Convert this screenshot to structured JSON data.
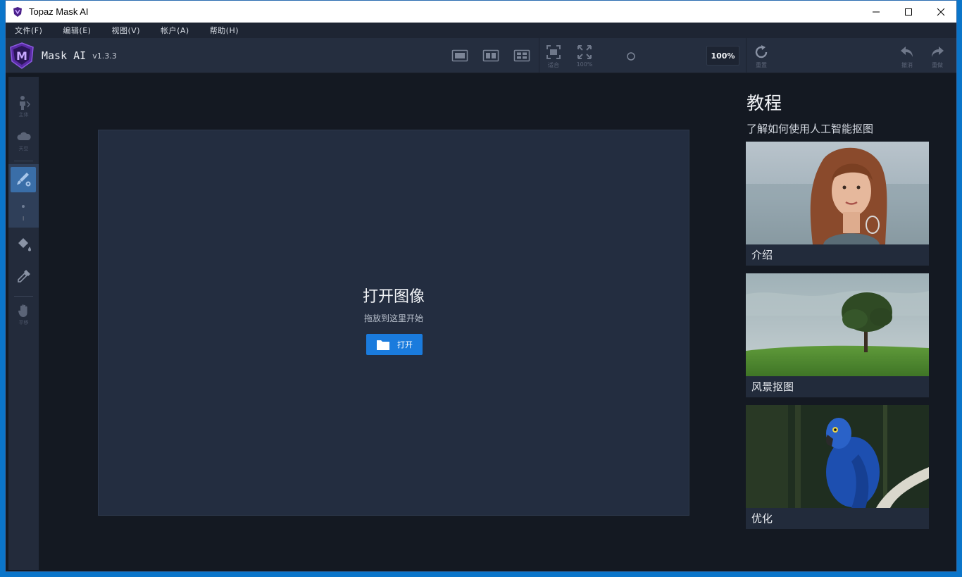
{
  "window": {
    "title": "Topaz Mask AI"
  },
  "menu": [
    "文件(F)",
    "编辑(E)",
    "视图(V)",
    "帐户(A)",
    "帮助(H)"
  ],
  "brand": {
    "name": "Mask AI",
    "version": "v1.3.3",
    "logo_letter": "M"
  },
  "toolbar": {
    "fit_label": "适合",
    "actual_label": "100%",
    "zoom_value": "100%",
    "reset_label": "重置",
    "undo_label": "撤消",
    "redo_label": "重做"
  },
  "tools": {
    "subject_label": "主体",
    "sky_label": "天空",
    "pan_label": "平移"
  },
  "canvas": {
    "title": "打开图像",
    "subtitle": "拖放到这里开始",
    "open_button": "打开"
  },
  "tutorials": {
    "title": "教程",
    "subtitle": "了解如何使用人工智能抠图",
    "cards": [
      {
        "caption": "介绍"
      },
      {
        "caption": "风景抠图"
      },
      {
        "caption": "优化"
      }
    ]
  },
  "colors": {
    "accent": "#1a7bdd",
    "brand_purple": "#6a2fb8",
    "background": "#141922",
    "panel": "#252e3f"
  }
}
